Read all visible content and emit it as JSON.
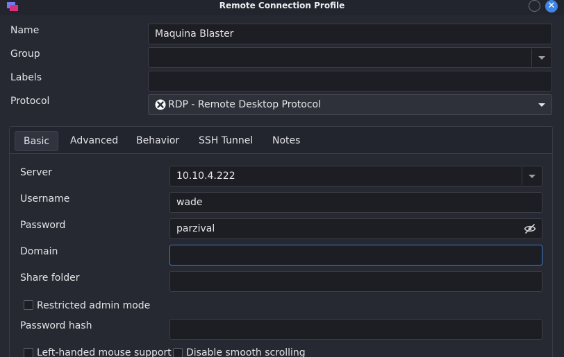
{
  "window": {
    "title": "Remote Connection Profile",
    "icon": "app-icon",
    "close_icon": "close-icon",
    "close_glyph": "✕"
  },
  "profile": {
    "name_label": "Name",
    "name_value": "Maquina Blaster",
    "group_label": "Group",
    "group_value": "",
    "labels_label": "Labels",
    "labels_value": "",
    "protocol_label": "Protocol",
    "protocol_value": "RDP - Remote Desktop Protocol"
  },
  "tabs": [
    {
      "label": "Basic",
      "active": true
    },
    {
      "label": "Advanced",
      "active": false
    },
    {
      "label": "Behavior",
      "active": false
    },
    {
      "label": "SSH Tunnel",
      "active": false
    },
    {
      "label": "Notes",
      "active": false
    }
  ],
  "basic": {
    "server_label": "Server",
    "server_value": "10.10.4.222",
    "username_label": "Username",
    "username_value": "wade",
    "password_label": "Password",
    "password_value": "parzival",
    "domain_label": "Domain",
    "domain_value": "",
    "share_folder_label": "Share folder",
    "share_folder_value": "",
    "restricted_admin_label": "Restricted admin mode",
    "restricted_admin_checked": false,
    "password_hash_label": "Password hash",
    "password_hash_value": "",
    "left_handed_label": "Left-handed mouse support",
    "left_handed_checked": false,
    "smooth_scroll_label": "Disable smooth scrolling",
    "smooth_scroll_checked": false
  },
  "colors": {
    "background": "#262932",
    "field_background": "#1c1e24",
    "accent": "#3d86e8",
    "focus_border": "#3d7bd9"
  }
}
